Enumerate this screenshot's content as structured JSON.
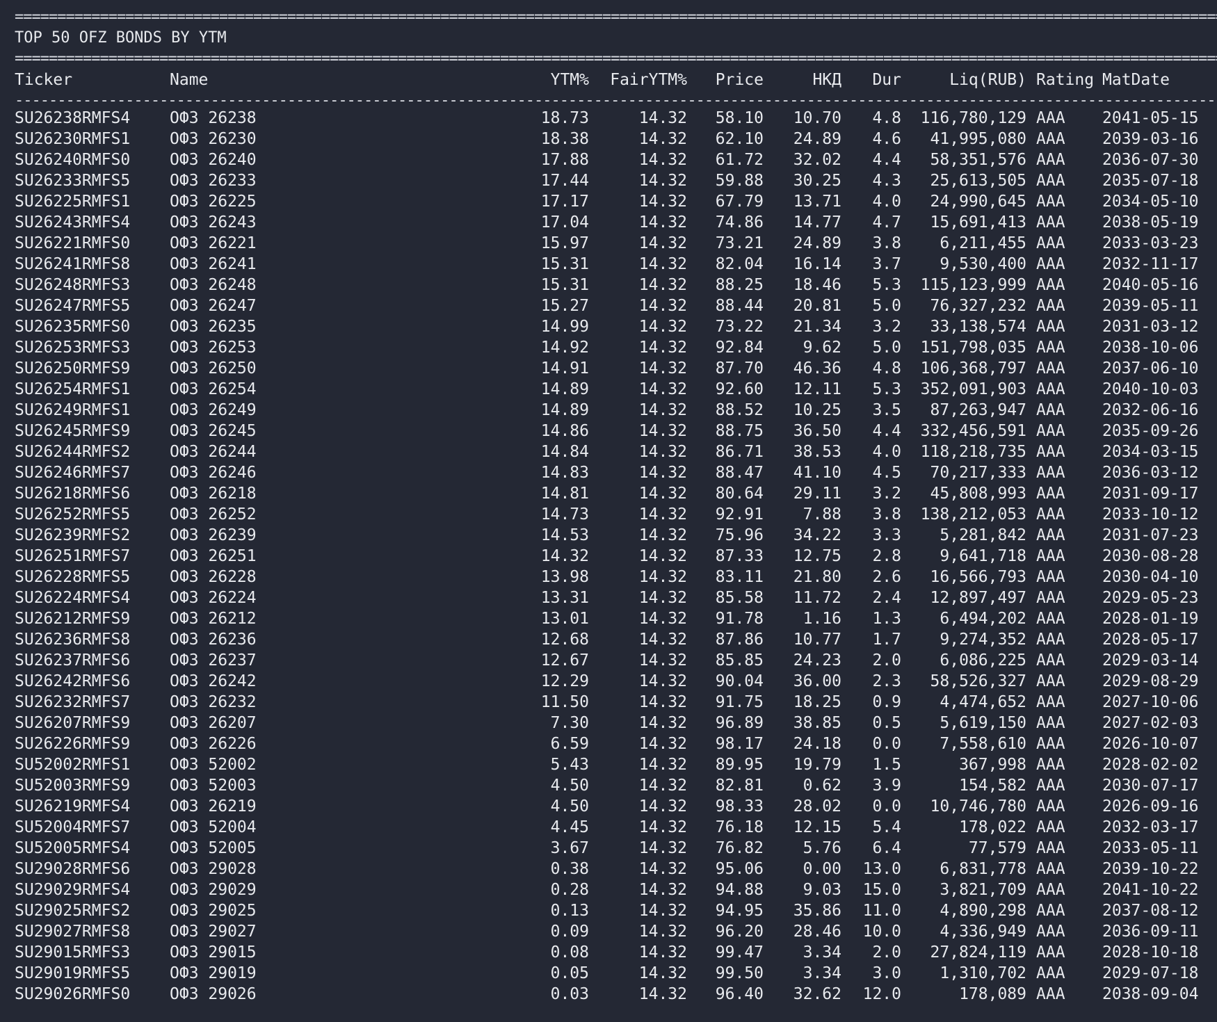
{
  "title": "TOP 50 OFZ BONDS BY YTM",
  "separators": {
    "double": "==========================================================================================================================================================================================================",
    "single": "------------------------------------------------------------------------------------------------------------------------------------------------------------------------------------------------------------------"
  },
  "columns": [
    "Ticker",
    "Name",
    "YTM%",
    "FairYTM%",
    "Price",
    "НКД",
    "Dur",
    "Liq(RUB)",
    "Rating",
    "MatDate"
  ],
  "rows": [
    [
      "SU26238RMFS4",
      "ОФЗ 26238",
      "18.73",
      "14.32",
      "58.10",
      "10.70",
      "4.8",
      "116,780,129",
      "AAA",
      "2041-05-15"
    ],
    [
      "SU26230RMFS1",
      "ОФЗ 26230",
      "18.38",
      "14.32",
      "62.10",
      "24.89",
      "4.6",
      "41,995,080",
      "AAA",
      "2039-03-16"
    ],
    [
      "SU26240RMFS0",
      "ОФЗ 26240",
      "17.88",
      "14.32",
      "61.72",
      "32.02",
      "4.4",
      "58,351,576",
      "AAA",
      "2036-07-30"
    ],
    [
      "SU26233RMFS5",
      "ОФЗ 26233",
      "17.44",
      "14.32",
      "59.88",
      "30.25",
      "4.3",
      "25,613,505",
      "AAA",
      "2035-07-18"
    ],
    [
      "SU26225RMFS1",
      "ОФЗ 26225",
      "17.17",
      "14.32",
      "67.79",
      "13.71",
      "4.0",
      "24,990,645",
      "AAA",
      "2034-05-10"
    ],
    [
      "SU26243RMFS4",
      "ОФЗ 26243",
      "17.04",
      "14.32",
      "74.86",
      "14.77",
      "4.7",
      "15,691,413",
      "AAA",
      "2038-05-19"
    ],
    [
      "SU26221RMFS0",
      "ОФЗ 26221",
      "15.97",
      "14.32",
      "73.21",
      "24.89",
      "3.8",
      "6,211,455",
      "AAA",
      "2033-03-23"
    ],
    [
      "SU26241RMFS8",
      "ОФЗ 26241",
      "15.31",
      "14.32",
      "82.04",
      "16.14",
      "3.7",
      "9,530,400",
      "AAA",
      "2032-11-17"
    ],
    [
      "SU26248RMFS3",
      "ОФЗ 26248",
      "15.31",
      "14.32",
      "88.25",
      "18.46",
      "5.3",
      "115,123,999",
      "AAA",
      "2040-05-16"
    ],
    [
      "SU26247RMFS5",
      "ОФЗ 26247",
      "15.27",
      "14.32",
      "88.44",
      "20.81",
      "5.0",
      "76,327,232",
      "AAA",
      "2039-05-11"
    ],
    [
      "SU26235RMFS0",
      "ОФЗ 26235",
      "14.99",
      "14.32",
      "73.22",
      "21.34",
      "3.2",
      "33,138,574",
      "AAA",
      "2031-03-12"
    ],
    [
      "SU26253RMFS3",
      "ОФЗ 26253",
      "14.92",
      "14.32",
      "92.84",
      "9.62",
      "5.0",
      "151,798,035",
      "AAA",
      "2038-10-06"
    ],
    [
      "SU26250RMFS9",
      "ОФЗ 26250",
      "14.91",
      "14.32",
      "87.70",
      "46.36",
      "4.8",
      "106,368,797",
      "AAA",
      "2037-06-10"
    ],
    [
      "SU26254RMFS1",
      "ОФЗ 26254",
      "14.89",
      "14.32",
      "92.60",
      "12.11",
      "5.3",
      "352,091,903",
      "AAA",
      "2040-10-03"
    ],
    [
      "SU26249RMFS1",
      "ОФЗ 26249",
      "14.89",
      "14.32",
      "88.52",
      "10.25",
      "3.5",
      "87,263,947",
      "AAA",
      "2032-06-16"
    ],
    [
      "SU26245RMFS9",
      "ОФЗ 26245",
      "14.86",
      "14.32",
      "88.75",
      "36.50",
      "4.4",
      "332,456,591",
      "AAA",
      "2035-09-26"
    ],
    [
      "SU26244RMFS2",
      "ОФЗ 26244",
      "14.84",
      "14.32",
      "86.71",
      "38.53",
      "4.0",
      "118,218,735",
      "AAA",
      "2034-03-15"
    ],
    [
      "SU26246RMFS7",
      "ОФЗ 26246",
      "14.83",
      "14.32",
      "88.47",
      "41.10",
      "4.5",
      "70,217,333",
      "AAA",
      "2036-03-12"
    ],
    [
      "SU26218RMFS6",
      "ОФЗ 26218",
      "14.81",
      "14.32",
      "80.64",
      "29.11",
      "3.2",
      "45,808,993",
      "AAA",
      "2031-09-17"
    ],
    [
      "SU26252RMFS5",
      "ОФЗ 26252",
      "14.73",
      "14.32",
      "92.91",
      "7.88",
      "3.8",
      "138,212,053",
      "AAA",
      "2033-10-12"
    ],
    [
      "SU26239RMFS2",
      "ОФЗ 26239",
      "14.53",
      "14.32",
      "75.96",
      "34.22",
      "3.3",
      "5,281,842",
      "AAA",
      "2031-07-23"
    ],
    [
      "SU26251RMFS7",
      "ОФЗ 26251",
      "14.32",
      "14.32",
      "87.33",
      "12.75",
      "2.8",
      "9,641,718",
      "AAA",
      "2030-08-28"
    ],
    [
      "SU26228RMFS5",
      "ОФЗ 26228",
      "13.98",
      "14.32",
      "83.11",
      "21.80",
      "2.6",
      "16,566,793",
      "AAA",
      "2030-04-10"
    ],
    [
      "SU26224RMFS4",
      "ОФЗ 26224",
      "13.31",
      "14.32",
      "85.58",
      "11.72",
      "2.4",
      "12,897,497",
      "AAA",
      "2029-05-23"
    ],
    [
      "SU26212RMFS9",
      "ОФЗ 26212",
      "13.01",
      "14.32",
      "91.78",
      "1.16",
      "1.3",
      "6,494,202",
      "AAA",
      "2028-01-19"
    ],
    [
      "SU26236RMFS8",
      "ОФЗ 26236",
      "12.68",
      "14.32",
      "87.86",
      "10.77",
      "1.7",
      "9,274,352",
      "AAA",
      "2028-05-17"
    ],
    [
      "SU26237RMFS6",
      "ОФЗ 26237",
      "12.67",
      "14.32",
      "85.85",
      "24.23",
      "2.0",
      "6,086,225",
      "AAA",
      "2029-03-14"
    ],
    [
      "SU26242RMFS6",
      "ОФЗ 26242",
      "12.29",
      "14.32",
      "90.04",
      "36.00",
      "2.3",
      "58,526,327",
      "AAA",
      "2029-08-29"
    ],
    [
      "SU26232RMFS7",
      "ОФЗ 26232",
      "11.50",
      "14.32",
      "91.75",
      "18.25",
      "0.9",
      "4,474,652",
      "AAA",
      "2027-10-06"
    ],
    [
      "SU26207RMFS9",
      "ОФЗ 26207",
      "7.30",
      "14.32",
      "96.89",
      "38.85",
      "0.5",
      "5,619,150",
      "AAA",
      "2027-02-03"
    ],
    [
      "SU26226RMFS9",
      "ОФЗ 26226",
      "6.59",
      "14.32",
      "98.17",
      "24.18",
      "0.0",
      "7,558,610",
      "AAA",
      "2026-10-07"
    ],
    [
      "SU52002RMFS1",
      "ОФЗ 52002",
      "5.43",
      "14.32",
      "89.95",
      "19.79",
      "1.5",
      "367,998",
      "AAA",
      "2028-02-02"
    ],
    [
      "SU52003RMFS9",
      "ОФЗ 52003",
      "4.50",
      "14.32",
      "82.81",
      "0.62",
      "3.9",
      "154,582",
      "AAA",
      "2030-07-17"
    ],
    [
      "SU26219RMFS4",
      "ОФЗ 26219",
      "4.50",
      "14.32",
      "98.33",
      "28.02",
      "0.0",
      "10,746,780",
      "AAA",
      "2026-09-16"
    ],
    [
      "SU52004RMFS7",
      "ОФЗ 52004",
      "4.45",
      "14.32",
      "76.18",
      "12.15",
      "5.4",
      "178,022",
      "AAA",
      "2032-03-17"
    ],
    [
      "SU52005RMFS4",
      "ОФЗ 52005",
      "3.67",
      "14.32",
      "76.82",
      "5.76",
      "6.4",
      "77,579",
      "AAA",
      "2033-05-11"
    ],
    [
      "SU29028RMFS6",
      "ОФЗ 29028",
      "0.38",
      "14.32",
      "95.06",
      "0.00",
      "13.0",
      "6,831,778",
      "AAA",
      "2039-10-22"
    ],
    [
      "SU29029RMFS4",
      "ОФЗ 29029",
      "0.28",
      "14.32",
      "94.88",
      "9.03",
      "15.0",
      "3,821,709",
      "AAA",
      "2041-10-22"
    ],
    [
      "SU29025RMFS2",
      "ОФЗ 29025",
      "0.13",
      "14.32",
      "94.95",
      "35.86",
      "11.0",
      "4,890,298",
      "AAA",
      "2037-08-12"
    ],
    [
      "SU29027RMFS8",
      "ОФЗ 29027",
      "0.09",
      "14.32",
      "96.20",
      "28.46",
      "10.0",
      "4,336,949",
      "AAA",
      "2036-09-11"
    ],
    [
      "SU29015RMFS3",
      "ОФЗ 29015",
      "0.08",
      "14.32",
      "99.47",
      "3.34",
      "2.0",
      "27,824,119",
      "AAA",
      "2028-10-18"
    ],
    [
      "SU29019RMFS5",
      "ОФЗ 29019",
      "0.05",
      "14.32",
      "99.50",
      "3.34",
      "3.0",
      "1,310,702",
      "AAA",
      "2029-07-18"
    ],
    [
      "SU29026RMFS0",
      "ОФЗ 29026",
      "0.03",
      "14.32",
      "96.40",
      "32.62",
      "12.0",
      "178,089",
      "AAA",
      "2038-09-04"
    ]
  ]
}
